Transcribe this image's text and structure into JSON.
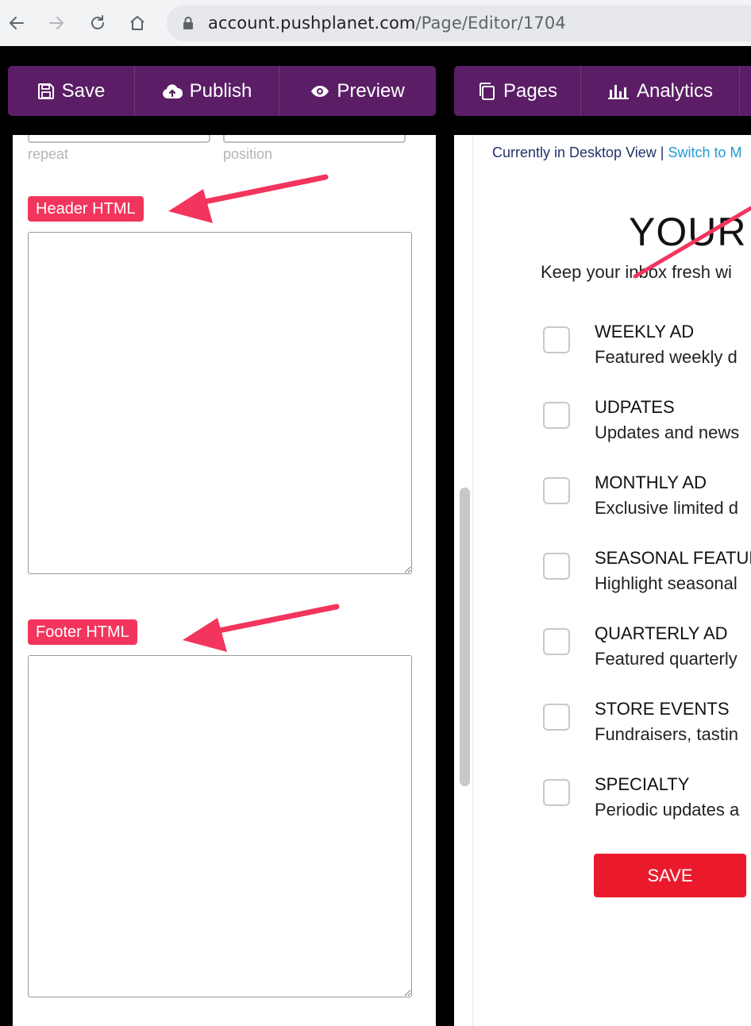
{
  "browser": {
    "url_host": "account.pushplanet.com",
    "url_path": "/Page/Editor/1704"
  },
  "toolbar_left": {
    "save_label": "Save",
    "publish_label": "Publish",
    "preview_label": "Preview"
  },
  "toolbar_right": {
    "pages_label": "Pages",
    "analytics_label": "Analytics"
  },
  "left_panel": {
    "repeat_hint": "repeat",
    "position_hint": "position",
    "header_tag": "Header HTML",
    "footer_tag": "Footer HTML",
    "header_value": "",
    "footer_value": ""
  },
  "preview": {
    "view_status": "Currently in Desktop View",
    "separator": "|",
    "switch_link": "Switch to M",
    "title": "YOUR",
    "subtitle": "Keep your inbox fresh wi",
    "options": [
      {
        "name": "WEEKLY AD",
        "desc": "Featured weekly d"
      },
      {
        "name": "UDPATES",
        "desc": "Updates and news"
      },
      {
        "name": "MONTHLY AD",
        "desc": "Exclusive limited d"
      },
      {
        "name": "SEASONAL FEATUR",
        "desc": "Highlight seasonal"
      },
      {
        "name": "QUARTERLY AD",
        "desc": "Featured quarterly"
      },
      {
        "name": "STORE EVENTS",
        "desc": "Fundraisers, tastin"
      },
      {
        "name": "SPECIALTY",
        "desc": "Periodic updates a"
      }
    ],
    "save_button": "SAVE"
  },
  "colors": {
    "toolbar_bg": "#5b1e66",
    "tag_bg": "#f2355d",
    "arrow": "#f2355d",
    "save_bg": "#ea1a2c",
    "link": "#1f9cd6"
  }
}
